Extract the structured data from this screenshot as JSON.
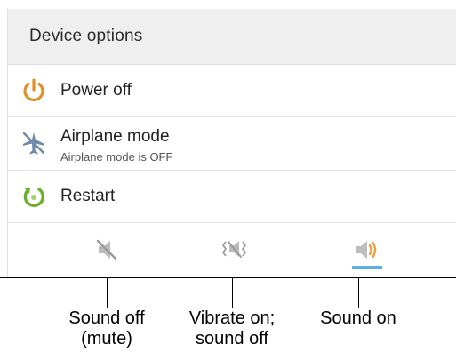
{
  "dialog": {
    "title": "Device options"
  },
  "menu": {
    "items": [
      {
        "label": "Power off",
        "icon": "power-icon"
      },
      {
        "label": "Airplane mode",
        "sublabel": "Airplane mode is OFF",
        "icon": "airplane-icon"
      },
      {
        "label": "Restart",
        "icon": "restart-icon"
      }
    ]
  },
  "sound_modes": {
    "buttons": [
      {
        "icon": "mute-icon",
        "selected": false
      },
      {
        "icon": "vibrate-icon",
        "selected": false
      },
      {
        "icon": "speaker-icon",
        "selected": true
      }
    ],
    "accent_color": "#5ab0e0"
  },
  "callouts": [
    {
      "text": "Sound off\n(mute)"
    },
    {
      "text": "Vibrate on;\nsound off"
    },
    {
      "text": "Sound on"
    }
  ],
  "colors": {
    "header_bg": "#efefef",
    "power_icon": "#e0902a",
    "airplane_icon": "#6e8aa8",
    "restart_icon": "#6ab02e"
  }
}
